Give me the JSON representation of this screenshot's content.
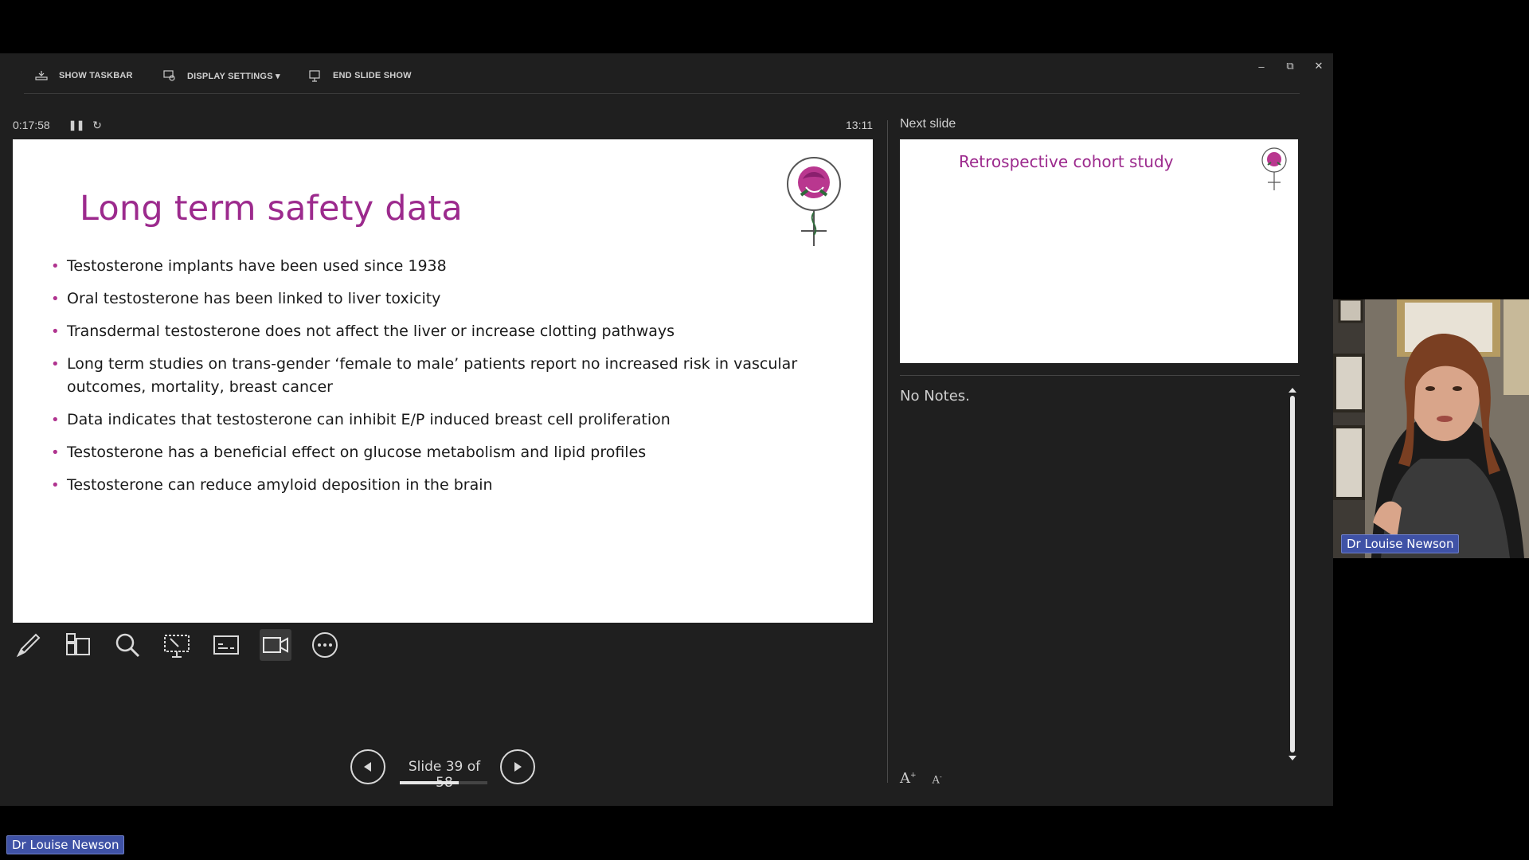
{
  "toolbar": {
    "show_taskbar": "SHOW TASKBAR",
    "display_settings": "DISPLAY SETTINGS ▾",
    "end_slide_show": "END SLIDE SHOW"
  },
  "window_controls": {
    "minimize": "–",
    "restore": "⧉",
    "close": "✕"
  },
  "timer": {
    "elapsed": "0:17:58",
    "clock": "13:11"
  },
  "current_slide": {
    "title": "Long term safety data",
    "bullets": [
      "Testosterone implants have been used since 1938",
      "Oral testosterone has been linked to liver toxicity",
      "Transdermal testosterone does not affect the liver or increase clotting pathways",
      "Long term studies on trans-gender ‘female to male’ patients report no increased risk in vascular outcomes, mortality, breast cancer",
      "Data indicates that testosterone can inhibit E/P induced breast cell proliferation",
      "Testosterone has a beneficial effect on glucose metabolism and lipid profiles",
      "Testosterone can reduce amyloid deposition in the brain"
    ]
  },
  "tools": [
    "pen-tool",
    "see-all-slides",
    "zoom",
    "pointer-options",
    "subtitles",
    "camera",
    "more-options"
  ],
  "navigation": {
    "slide_counter": "Slide 39 of 58",
    "progress": 0.672
  },
  "next_slide": {
    "label": "Next slide",
    "title": "Retrospective cohort study"
  },
  "notes": {
    "text": "No Notes.",
    "increase_font": "A",
    "decrease_font": "A"
  },
  "participants": {
    "webcam_name": "Dr Louise Newson",
    "host_name": "Dr Louise Newson"
  },
  "colors": {
    "accent": "#9c2a8d",
    "name_tag": "#3f52a6"
  }
}
